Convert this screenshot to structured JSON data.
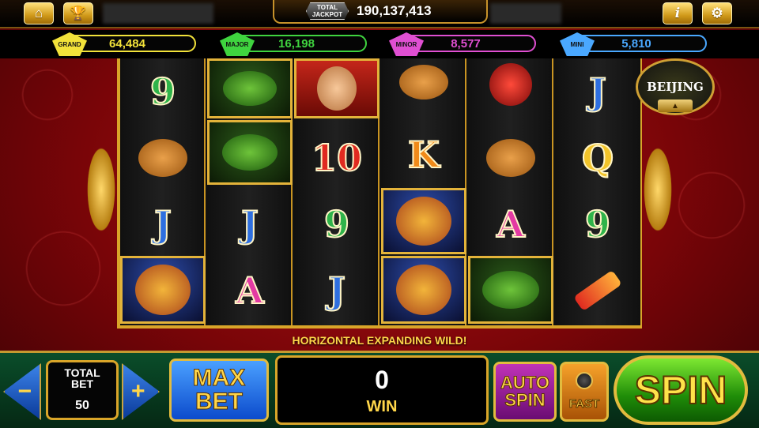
{
  "top_bar": {
    "total_jackpot_badge": [
      "TOTAL",
      "JACKPOT"
    ],
    "total_jackpot_value": "190,137,413",
    "icons": [
      "home-icon",
      "trophy-icon",
      "info-icon",
      "gear-icon"
    ]
  },
  "progressives": [
    {
      "label": "GRAND",
      "value": "64,484",
      "color": "#f2e23a"
    },
    {
      "label": "MAJOR",
      "value": "16,198",
      "color": "#3fd43f"
    },
    {
      "label": "MINOR",
      "value": "8,577",
      "color": "#e04fd2"
    },
    {
      "label": "MINI",
      "value": "5,810",
      "color": "#4aa8ff"
    }
  ],
  "reels": [
    [
      "9",
      "mooncake",
      "J",
      "dragon"
    ],
    [
      "turtle",
      "turtle",
      "J",
      "A"
    ],
    [
      "fortune-god",
      "10",
      "9",
      "J"
    ],
    [
      "mooncake",
      "K",
      "dragon",
      "dragon"
    ],
    [
      "lantern",
      "mooncake",
      "A",
      "turtle"
    ],
    [
      "J",
      "Q",
      "9",
      "firecracker"
    ]
  ],
  "beijing_badge": "BEIJING",
  "message": "HORIZONTAL EXPANDING WILD!",
  "bottom": {
    "minus_label": "−",
    "plus_label": "+",
    "total_bet_label_1": "TOTAL",
    "total_bet_label_2": "BET",
    "total_bet_value": "50",
    "max_bet_1": "MAX",
    "max_bet_2": "BET",
    "win_value": "0",
    "win_label": "WIN",
    "auto_spin_1": "AUTO",
    "auto_spin_2": "SPIN",
    "fast_label": "FAST",
    "spin_label": "SPIN"
  },
  "colors": {
    "gold": "#d9a529",
    "background_red": "#a10f15"
  }
}
